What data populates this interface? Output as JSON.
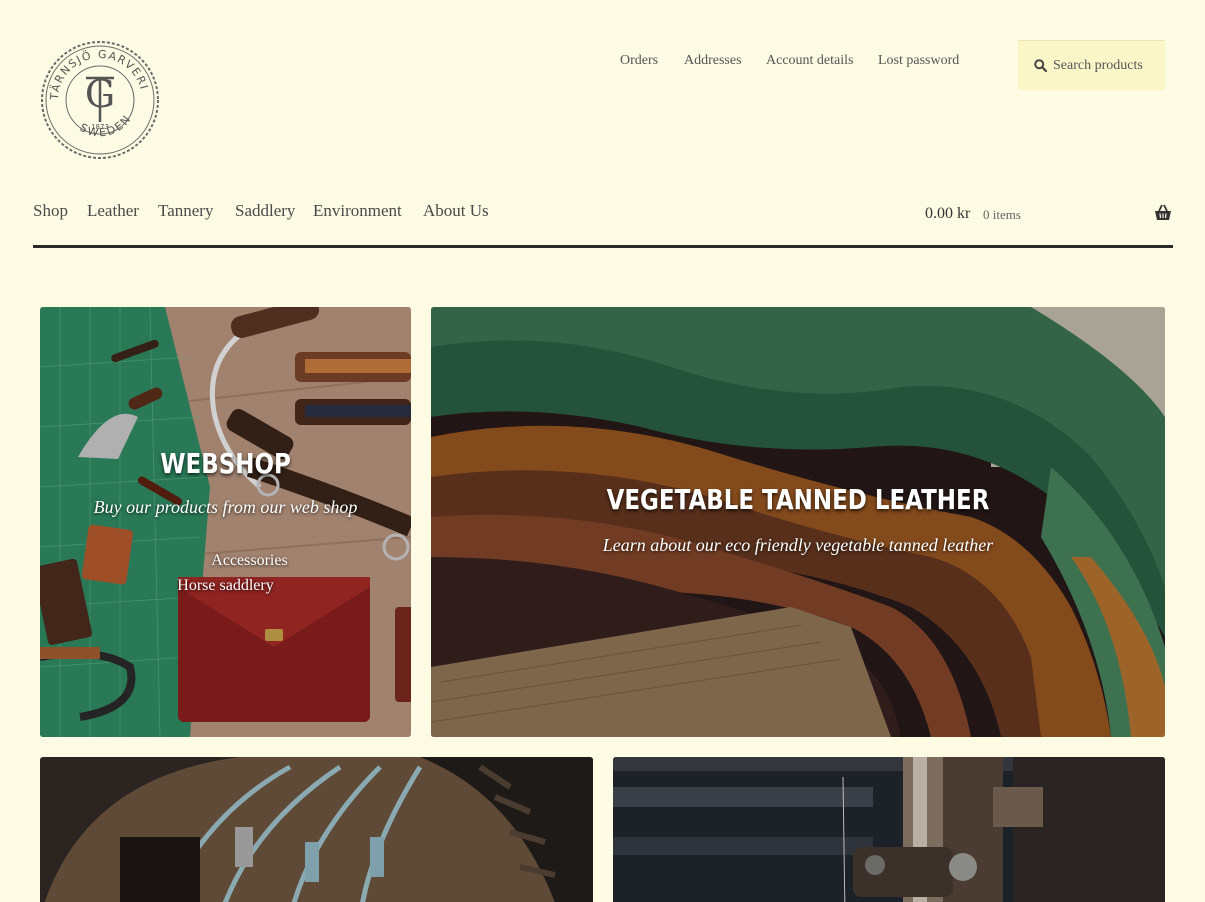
{
  "logo": {
    "ring_text_top": "TÄRNSJÖ GARVERI A.B.",
    "ring_text_bottom": "SWEDEN",
    "year": "1873",
    "monogram": "TG"
  },
  "account_links": [
    "Orders",
    "Addresses",
    "Account details",
    "Lost password"
  ],
  "search": {
    "placeholder": "Search products",
    "icon": "search-icon"
  },
  "main_nav": [
    "Shop",
    "Leather",
    "Tannery",
    "Saddlery",
    "Environment",
    "About Us"
  ],
  "cart": {
    "total": "0.00 kr",
    "count": "0 items",
    "icon": "basket-icon"
  },
  "tiles": {
    "webshop": {
      "title": "WEBSHOP",
      "subtitle": "Buy our products from our web shop",
      "links": [
        "Accessories",
        "Horse saddlery"
      ]
    },
    "leather": {
      "title": "VEGETABLE TANNED LEATHER",
      "subtitle": "Learn about our eco friendly vegetable tanned leather"
    }
  },
  "colors": {
    "background": "#fdfbe3",
    "search_bg": "#fbf6c8",
    "rule": "#2b2b2b"
  }
}
